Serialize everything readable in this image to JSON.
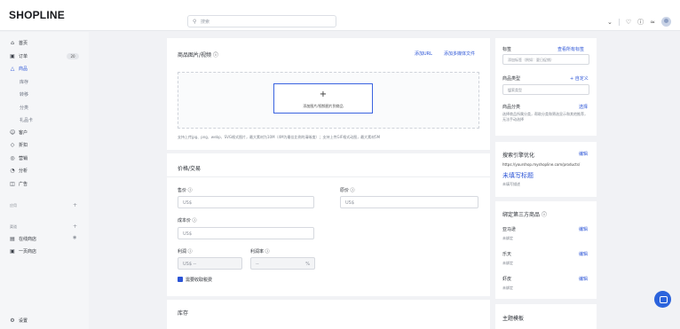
{
  "topbar": {
    "logo": "SHOPLINE",
    "search_placeholder": "搜索",
    "icons": [
      "chevron-down-icon",
      "bell-icon",
      "help-icon",
      "wifi-icon",
      "avatar"
    ]
  },
  "sidebar": {
    "items": [
      {
        "label": "首页",
        "icon": "home-icon"
      },
      {
        "label": "订单",
        "icon": "order-icon",
        "badge": "20"
      },
      {
        "label": "商品",
        "icon": "bag-icon",
        "active": true
      },
      {
        "label": "客户",
        "icon": "user-icon"
      },
      {
        "label": "折扣",
        "icon": "tag-icon"
      },
      {
        "label": "营销",
        "icon": "target-icon"
      },
      {
        "label": "分析",
        "icon": "chart-icon"
      },
      {
        "label": "广告",
        "icon": "ad-icon"
      }
    ],
    "product_sub": [
      "库存",
      "转移",
      "分类",
      "礼品卡"
    ],
    "section_apps": "应用",
    "section_channels": "渠道",
    "channels": [
      {
        "label": "在线商店",
        "icon": "store-icon"
      },
      {
        "label": "一页商店",
        "icon": "page-store-icon"
      }
    ],
    "settings": "设置"
  },
  "media": {
    "title": "商品图片/视频",
    "add_url": "添加URL",
    "add_multimedia": "添加多媒体文件",
    "upload_label": "添加图片/视频图片到商品",
    "hint": "支持上传jpg、png、webp、SVG格式图片，最大素材为10M（4M为最佳比例的清晰度）；支持上传GIF格式动图，最大素材5M"
  },
  "pricing": {
    "title": "价格/交易",
    "price_label": "售价",
    "price_ph": "US$",
    "compare_label": "原价",
    "compare_ph": "US$",
    "cost_label": "成本价",
    "cost_ph": "US$",
    "profit_label": "利润",
    "profit_ph": "US$ --",
    "margin_label": "利润率",
    "margin_ph": "--",
    "margin_unit": "%",
    "tax_label": "需要收取税费"
  },
  "inventory": {
    "title": "库存"
  },
  "right": {
    "tags_title": "标签",
    "tags_link": "查看所有标签",
    "tags_ph": "添加标签（例如：夏日促销）",
    "type_title": "商品类型",
    "type_link": "+ 自定义",
    "type_ph": "搜索类型",
    "category_title": "商品分类",
    "category_link": "选择",
    "category_desc": "选择商品所属分类，帮助分类和筛选显示和其他推荐，无法手动选择",
    "seo_title": "搜索引擎优化",
    "seo_link": "编辑",
    "seo_url": "https://yourshop.myshopline.com/products/",
    "seo_headline": "未填写标题",
    "seo_desc": "未填写描述",
    "third_party_title": "绑定第三方商品",
    "third_party": [
      {
        "name": "亚马逊",
        "status": "未绑定",
        "action": "编辑"
      },
      {
        "name": "乐天",
        "status": "未绑定",
        "action": "编辑"
      },
      {
        "name": "虾皮",
        "status": "未绑定",
        "action": "编辑"
      }
    ],
    "theme_title": "主题模板"
  },
  "colors": {
    "accent": "#2b54d6",
    "fab": "#2b63dc"
  }
}
